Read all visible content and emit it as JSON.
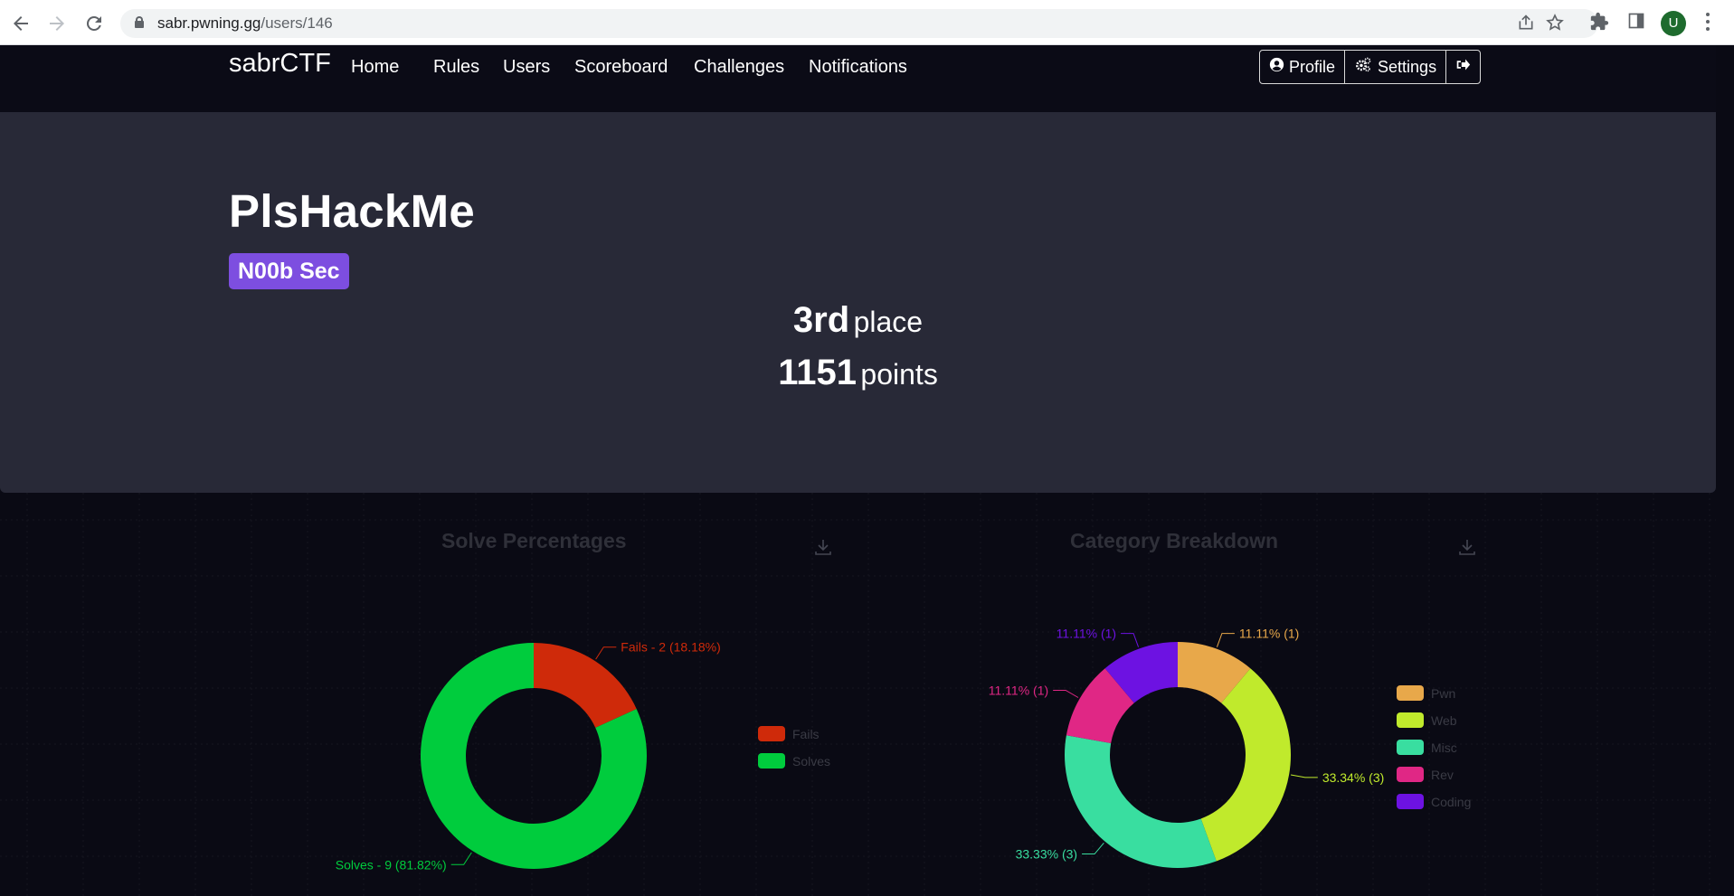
{
  "browser": {
    "url_host": "sabr.pwning.gg",
    "url_path": "/users/146",
    "avatar_letter": "U",
    "icons": [
      "back-arrow-icon",
      "forward-arrow-icon",
      "reload-icon",
      "lock-icon",
      "share-icon",
      "bookmark-star-icon",
      "extensions-icon",
      "side-panel-icon",
      "menu-kebab-icon"
    ]
  },
  "navbar": {
    "brand": "sabrCTF",
    "links": [
      "Home",
      "Rules",
      "Users",
      "Scoreboard",
      "Challenges",
      "Notifications"
    ],
    "profile_label": "Profile",
    "settings_label": "Settings",
    "icons": [
      "user-circle-icon",
      "gears-icon",
      "sign-out-icon"
    ]
  },
  "user": {
    "name": "PlsHackMe",
    "team": "N00b Sec",
    "place_num": "3rd",
    "place_label": "place",
    "points_num": "1151",
    "points_label": "points",
    "team_color": "#7d4ee0"
  },
  "chart_data": [
    {
      "type": "pie",
      "title": "Solve Percentages",
      "donut": true,
      "labels": [
        "Fails",
        "Solves"
      ],
      "values": [
        2,
        9
      ],
      "percentages": [
        18.18,
        81.82
      ],
      "colors": [
        "#cf2a0a",
        "#00cc3d"
      ],
      "slice_labels": [
        "Fails - 2 (18.18%)",
        "Solves - 9 (81.82%)"
      ],
      "legend_placement": "right"
    },
    {
      "type": "pie",
      "title": "Category Breakdown",
      "donut": true,
      "labels": [
        "Pwn",
        "Web",
        "Misc",
        "Rev",
        "Coding"
      ],
      "values": [
        1,
        3,
        3,
        1,
        1
      ],
      "percentages": [
        11.11,
        33.34,
        33.33,
        11.11,
        11.11
      ],
      "colors": [
        "#e8a84a",
        "#c0ea2c",
        "#39dea0",
        "#e02785",
        "#6d12e2"
      ],
      "slice_labels": [
        "11.11% (1)",
        "33.34% (3)",
        "33.33% (3)",
        "11.11% (1)",
        "11.11% (1)"
      ],
      "legend_placement": "right"
    }
  ]
}
